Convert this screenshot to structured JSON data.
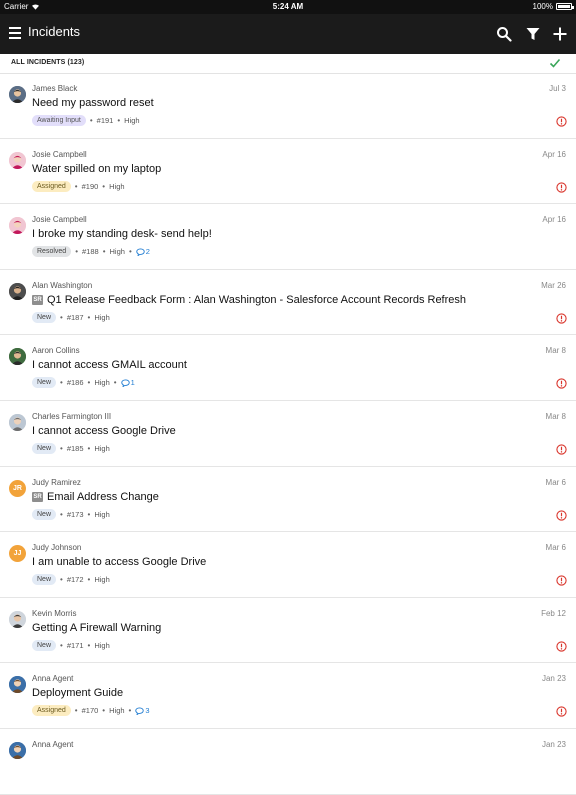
{
  "status_bar": {
    "carrier": "Carrier",
    "time": "5:24 AM",
    "battery": "100%"
  },
  "nav": {
    "title": "Incidents"
  },
  "filter": {
    "label": "ALL INCIDENTS (123)"
  },
  "colors": {
    "comment": "#1e7bd1",
    "alert": "#d9342b",
    "check": "#3aa65a",
    "navbar": "#1b1b1b"
  },
  "incidents": [
    {
      "author": "James Black",
      "date": "Jul 3",
      "title": "Need my password reset",
      "sr": "",
      "status": "Awaiting Input",
      "number": "#191",
      "priority": "High",
      "comments": ""
    },
    {
      "author": "Josie Campbell",
      "date": "Apr 16",
      "title": "Water spilled on my laptop",
      "sr": "",
      "status": "Assigned",
      "number": "#190",
      "priority": "High",
      "comments": ""
    },
    {
      "author": "Josie Campbell",
      "date": "Apr 16",
      "title": "I broke my standing desk- send help!",
      "sr": "",
      "status": "Resolved",
      "number": "#188",
      "priority": "High",
      "comments": "2"
    },
    {
      "author": "Alan Washington",
      "date": "Mar 26",
      "title": "Q1 Release Feedback Form : Alan Washington - Salesforce Account Records Refresh",
      "sr": "SR",
      "status": "New",
      "number": "#187",
      "priority": "High",
      "comments": ""
    },
    {
      "author": "Aaron Collins",
      "date": "Mar 8",
      "title": "I cannot access GMAIL account",
      "sr": "",
      "status": "New",
      "number": "#186",
      "priority": "High",
      "comments": "1"
    },
    {
      "author": "Charles Farmington III",
      "date": "Mar 8",
      "title": "I cannot access Google Drive",
      "sr": "",
      "status": "New",
      "number": "#185",
      "priority": "High",
      "comments": ""
    },
    {
      "author": "Judy Ramirez",
      "date": "Mar 6",
      "title": "Email Address Change",
      "sr": "SR",
      "status": "New",
      "number": "#173",
      "priority": "High",
      "comments": "",
      "initials": "JR"
    },
    {
      "author": "Judy Johnson",
      "date": "Mar 6",
      "title": "I am unable to access Google Drive",
      "sr": "",
      "status": "New",
      "number": "#172",
      "priority": "High",
      "comments": "",
      "initials": "JJ"
    },
    {
      "author": "Kevin Morris",
      "date": "Feb 12",
      "title": "Getting A Firewall Warning",
      "sr": "",
      "status": "New",
      "number": "#171",
      "priority": "High",
      "comments": ""
    },
    {
      "author": "Anna Agent",
      "date": "Jan 23",
      "title": "Deployment Guide",
      "sr": "",
      "status": "Assigned",
      "number": "#170",
      "priority": "High",
      "comments": "3"
    },
    {
      "author": "Anna Agent",
      "date": "Jan 23",
      "title": "",
      "sr": "",
      "status": "",
      "number": "",
      "priority": "",
      "comments": ""
    }
  ]
}
